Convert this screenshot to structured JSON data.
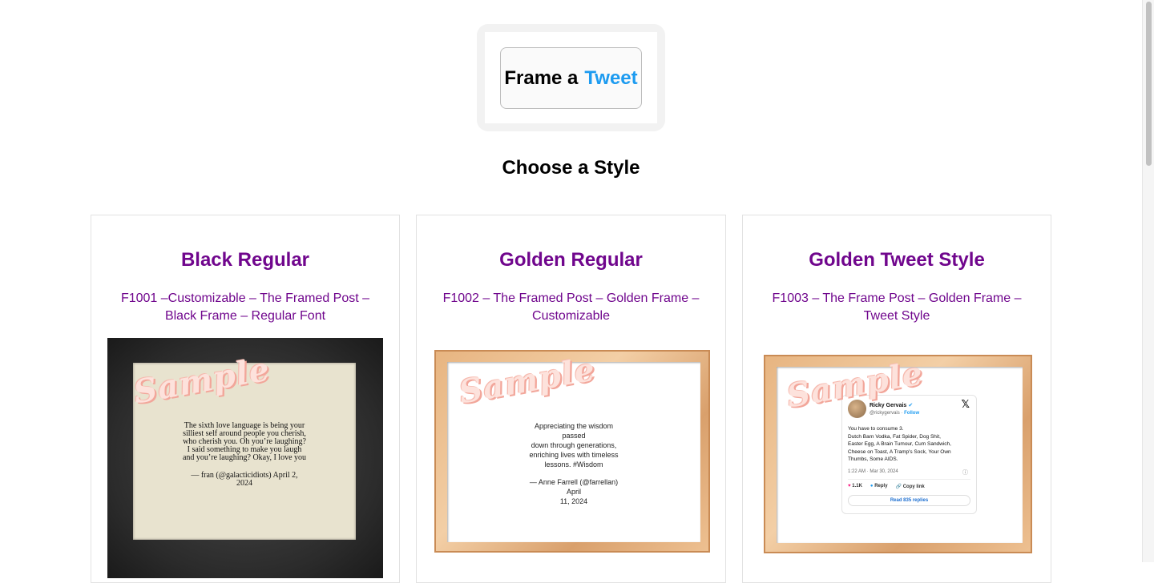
{
  "logo": {
    "part1": "Frame a",
    "part2": "Tweet"
  },
  "page": {
    "title": "Choose a Style"
  },
  "watermark": "Sample",
  "cards": [
    {
      "title": "Black Regular",
      "subtitle": "F1001 –Customizable – The Framed Post – Black Frame – Regular Font",
      "quote_lines": [
        "The sixth love language is being your",
        "silliest self around people you cherish,",
        "who cherish you. Oh you’re laughing?",
        "I said something to make you laugh",
        "and you’re laughing? Okay, I love you"
      ],
      "attribution_lines": [
        "— fran (@galacticidiots) April 2,",
        "2024"
      ]
    },
    {
      "title": "Golden Regular",
      "subtitle": "F1002 – The Framed Post – Golden Frame – Customizable",
      "quote_lines": [
        "Appreciating the wisdom passed",
        "down through generations,",
        "enriching lives with timeless",
        "lessons. #Wisdom"
      ],
      "attribution_lines": [
        "— Anne Farrell (@farrellan) April",
        "11, 2024"
      ]
    },
    {
      "title": "Golden Tweet Style",
      "subtitle": "F1003 – The Frame Post – Golden Frame – Tweet Style",
      "tweet": {
        "name": "Ricky Gervais",
        "handle": "@rickygervais",
        "follow": "Follow",
        "body_lines": [
          "You have to consume 3.",
          "Dutch Barn Vodka, Fat Spider, Dog Shit,",
          "Easter Egg, A Brain Tumour, Cum Sandwich,",
          "Cheese on Toast, A Tramp's Sock, Your Own",
          "Thumbs, Some AIDS."
        ],
        "time": "1:22 AM · Mar 30, 2024",
        "likes": "1.1K",
        "reply": "Reply",
        "copy": "Copy link",
        "read_replies": "Read 835 replies"
      }
    }
  ],
  "colors": {
    "accent_blue": "#1d9bf0",
    "title_purple": "#70068d"
  }
}
